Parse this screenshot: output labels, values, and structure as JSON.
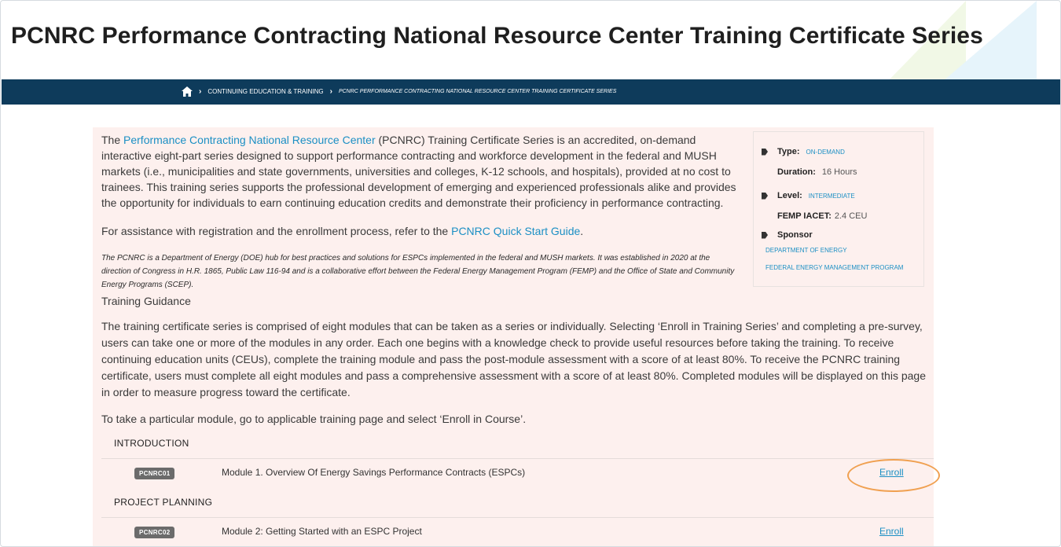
{
  "page": {
    "title": "PCNRC Performance Contracting National Resource Center Training Certificate Series"
  },
  "breadcrumb": {
    "home_icon": "home-icon",
    "items": [
      "CONTINUING EDUCATION & TRAINING",
      "PCNRC PERFORMANCE CONTRACTING NATIONAL RESOURCE CENTER TRAINING CERTIFICATE SERIES"
    ]
  },
  "intro": {
    "pre": "The ",
    "link": "Performance Contracting National Resource Center",
    "post": " (PCNRC) Training Certificate Series is an accredited, on-demand interactive eight-part series designed to support performance contracting and workforce development in the federal and MUSH markets (i.e., municipalities and state governments, universities and colleges, K-12 schools, and hospitals), provided at no cost to trainees. This training series supports the professional development of emerging and experienced professionals alike and provides the opportunity for individuals to earn continuing education credits and demonstrate their proficiency in performance contracting."
  },
  "assist": {
    "pre": "For assistance with registration and the enrollment process, refer to the ",
    "link": "PCNRC Quick Start Guide",
    "post": "."
  },
  "doe_note": "The PCNRC is a Department of Energy (DOE) hub for best practices and solutions for ESPCs implemented in the federal and MUSH markets. It was established in 2020 at the direction of Congress in H.R. 1865, Public Law 116-94 and is a collaborative effort between the Federal Energy Management Program (FEMP) and the Office of State and Community Energy Programs (SCEP).",
  "guidance": {
    "heading": "Training Guidance",
    "body": "The training certificate series is comprised of eight modules that can be taken as a series or individually. Selecting ‘Enroll in Training Series’ and completing a pre-survey, users can take one or more of the modules in any order. Each one begins with a knowledge check to provide useful resources before taking the training. To receive continuing education units (CEUs), complete the training module and pass the post-module assessment with a score of at least 80%. To receive the PCNRC training certificate, users must complete all eight modules and pass a comprehensive assessment with a score of at least 80%. Completed modules will be displayed on this page in order to measure progress toward the certificate.",
    "take": "To take a particular module, go to applicable training page and select ‘Enroll in Course’."
  },
  "sidebar": {
    "type_label": "Type:",
    "type_value": "ON-DEMAND",
    "duration_label": "Duration:",
    "duration_value": "16 Hours",
    "level_label": "Level:",
    "level_value": "INTERMEDIATE",
    "femp_label": "FEMP IACET:",
    "femp_value": "2.4 CEU",
    "sponsor_label": "Sponsor",
    "sponsors": [
      "DEPARTMENT OF ENERGY",
      "FEDERAL ENERGY MANAGEMENT PROGRAM"
    ]
  },
  "sections": [
    {
      "heading": "INTRODUCTION",
      "modules": [
        {
          "code": "PCNRC01",
          "title": "Module 1. Overview Of Energy Savings Performance Contracts (ESPCs)",
          "action": "Enroll"
        }
      ]
    },
    {
      "heading": "PROJECT PLANNING",
      "modules": [
        {
          "code": "PCNRC02",
          "title": "Module 2: Getting Started with an ESPC Project",
          "action": "Enroll"
        }
      ]
    }
  ],
  "colors": {
    "nav_bg": "#0e3b5b",
    "content_bg": "#fdf0ee",
    "link": "#1b8fc4",
    "highlight": "#f0a050"
  }
}
